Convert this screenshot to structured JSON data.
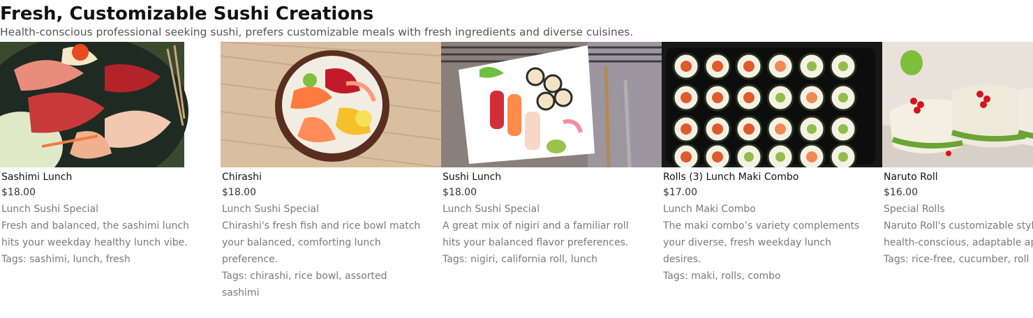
{
  "header": {
    "title": "Fresh, Customizable Sushi Creations",
    "subtitle": "Health-conscious professional seeking sushi, prefers customizable meals with fresh ingredients and diverse cuisines."
  },
  "tags_prefix": "Tags: ",
  "cards": [
    {
      "name": "Sashimi Lunch",
      "price": "$18.00",
      "category": "Lunch Sushi Special",
      "description": "Fresh and balanced, the sashimi lunch hits your weekday healthy lunch vibe.",
      "tags": "sashimi, lunch, fresh"
    },
    {
      "name": "Chirashi",
      "price": "$18.00",
      "category": "Lunch Sushi Special",
      "description": "Chirashi's fresh fish and rice bowl match your balanced, comforting lunch preference.",
      "tags": "chirashi, rice bowl, assorted sashimi"
    },
    {
      "name": "Sushi Lunch",
      "price": "$18.00",
      "category": "Lunch Sushi Special",
      "description": "A great mix of nigiri and a familiar roll hits your balanced flavor preferences.",
      "tags": "nigiri, california roll, lunch"
    },
    {
      "name": "Rolls (3) Lunch Maki Combo",
      "price": "$17.00",
      "category": "Lunch Maki Combo",
      "description": "The maki combo’s variety complements your diverse, fresh weekday lunch desires.",
      "tags": "maki, rolls, combo"
    },
    {
      "name": "Naruto Roll",
      "price": "$16.00",
      "category": "Special Rolls",
      "description": "Naruto Roll's customizable style fits your health-conscious, adaptable approach.",
      "tags": "rice-free, cucumber, roll"
    }
  ],
  "colors": {
    "title": "#111111",
    "subtitle": "#555555",
    "muted": "#7a7a7a"
  }
}
